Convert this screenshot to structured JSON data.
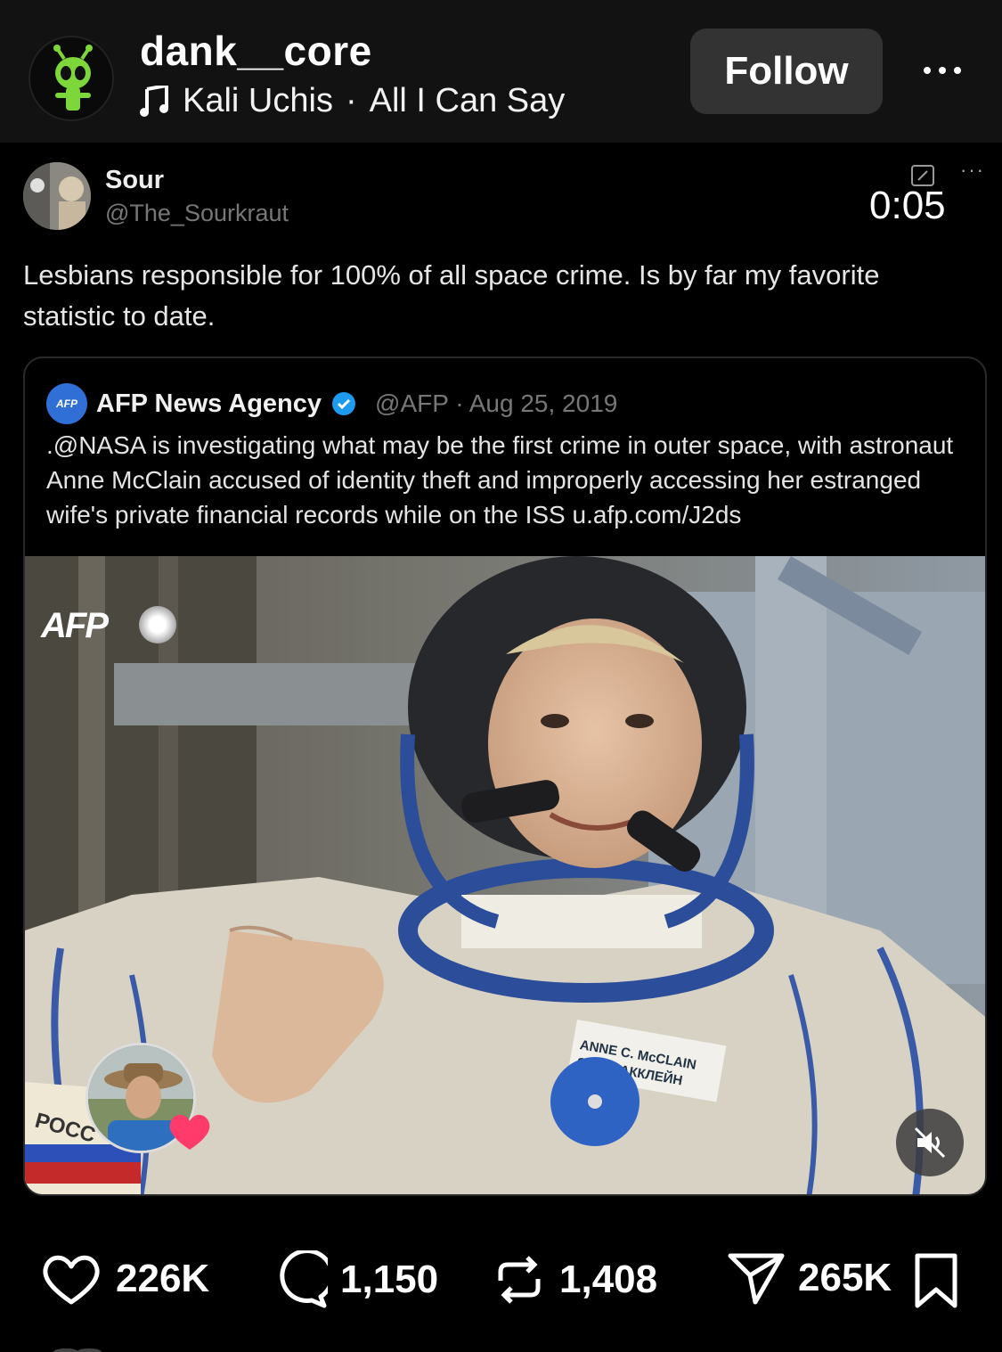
{
  "header": {
    "username": "dank__core",
    "song_artist": "Kali Uchis",
    "song_separator": "·",
    "song_title": "All I Can Say",
    "follow_label": "Follow"
  },
  "post": {
    "author_name": "Sour",
    "author_handle": "@The_Sourkraut",
    "timer": "0:05",
    "text": "Lesbians responsible for 100% of all space crime. Is by far my favorite statistic to date."
  },
  "quote": {
    "badge": "AFP",
    "name": "AFP News Agency",
    "handle": "@AFP",
    "separator": "·",
    "date": "Aug 25, 2019",
    "text": ".@NASA is investigating what may be the first crime in outer space, with astronaut Anne McClain accused of identity theft and improperly accessing her estranged wife's private financial records while on the ISS u.afp.com/J2ds",
    "photo_logo": "AFP",
    "name_tag_line1": "ANNE C. McCLAIN",
    "name_tag_line2": "ЭНН МАККЛЕЙН",
    "patch_text": "РОСС"
  },
  "actions": {
    "likes": "226K",
    "comments": "1,150",
    "reposts": "1,408",
    "shares": "265K"
  },
  "colors": {
    "header_bg": "#121212",
    "follow_bg": "#333333",
    "verified_blue": "#1d9bf0",
    "afp_blue": "#2f6fd6",
    "heart_pink": "#ff3b6b"
  },
  "icons": [
    "alien-avatar",
    "music-note-icon",
    "more-icon",
    "edit-icon",
    "verified-icon",
    "mute-icon",
    "heart-icon",
    "comment-icon",
    "repost-icon",
    "share-icon",
    "bookmark-icon"
  ]
}
